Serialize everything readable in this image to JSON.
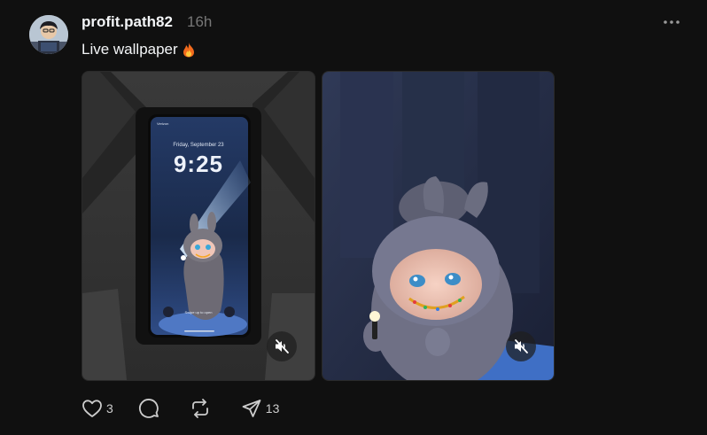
{
  "post": {
    "username": "profit.path82",
    "timestamp": "16h",
    "caption": "Live wallpaper",
    "caption_emoji": "fire-emoji",
    "more_icon": "more-horizontal-icon"
  },
  "media": [
    {
      "phone": {
        "carrier": "Verizon",
        "date": "Friday, September 23",
        "time": "9:25",
        "swipe_hint": "Swipe up to open"
      },
      "mute_icon": "speaker-muted-icon"
    },
    {
      "mute_icon": "speaker-muted-icon"
    }
  ],
  "actions": {
    "like_count": "3",
    "reply_count": "",
    "repost_count": "",
    "share_count": "13"
  },
  "colors": {
    "background": "#101010",
    "text_primary": "#f3f5f7",
    "text_secondary": "#777777"
  }
}
